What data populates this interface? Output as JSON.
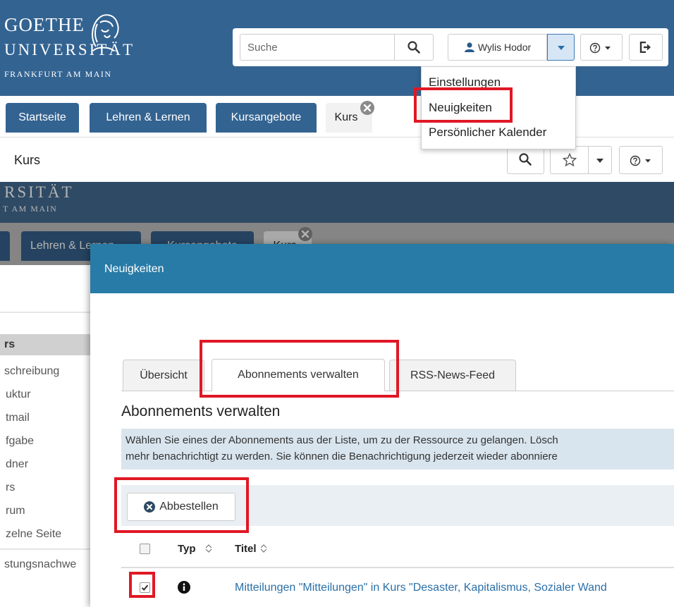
{
  "top": {
    "logo": {
      "line1": "GOETHE",
      "line2": "UNIVERSITÄT",
      "line3": "FRANKFURT AM MAIN"
    },
    "search": {
      "placeholder": "Suche"
    },
    "user": {
      "name": "Wylis Hodor"
    },
    "user_menu": {
      "items": [
        "Einstellungen",
        "Neuigkeiten",
        "Persönlicher Kalender"
      ]
    },
    "tabs": [
      "Startseite",
      "Lehren & Lernen",
      "Kursangebote",
      "Kurs"
    ],
    "breadcrumb": "Kurs"
  },
  "bottom": {
    "logo": {
      "line2_fragment": "RSITÄT",
      "line3_fragment": "T AM MAIN"
    },
    "tabs": [
      "Lehren & Lernen",
      "Kursangebote",
      "Kurs"
    ],
    "sidebar": {
      "section": "rs",
      "items": [
        "schreibung",
        "uktur",
        "tmail",
        "fgabe",
        "dner",
        "rs",
        "rum",
        "zelne Seite",
        "stungsnachwe"
      ]
    },
    "modal": {
      "title": "Neuigkeiten",
      "tabs": [
        "Übersicht",
        "Abonnements verwalten",
        "RSS-News-Feed"
      ],
      "heading": "Abonnements verwalten",
      "info_line1": "Wählen Sie eines der Abonnements aus der Liste, um zu der Ressource zu gelangen. Lösch",
      "info_line2": "mehr benachrichtigt zu werden. Sie können die Benachrichtigung jederzeit wieder abonniere",
      "unsubscribe_label": "Abbestellen",
      "table": {
        "col_type": "Typ",
        "col_title": "Titel",
        "rows": [
          {
            "title": "Mitteilungen \"Mitteilungen\" in Kurs \"Desaster, Kapitalismus, Sozialer Wand",
            "checked": true
          }
        ]
      }
    }
  },
  "colors": {
    "header_blue": "#336391",
    "modal_header": "#287ba6",
    "highlight_red": "#e01825",
    "link_blue": "#2a6fa8"
  }
}
